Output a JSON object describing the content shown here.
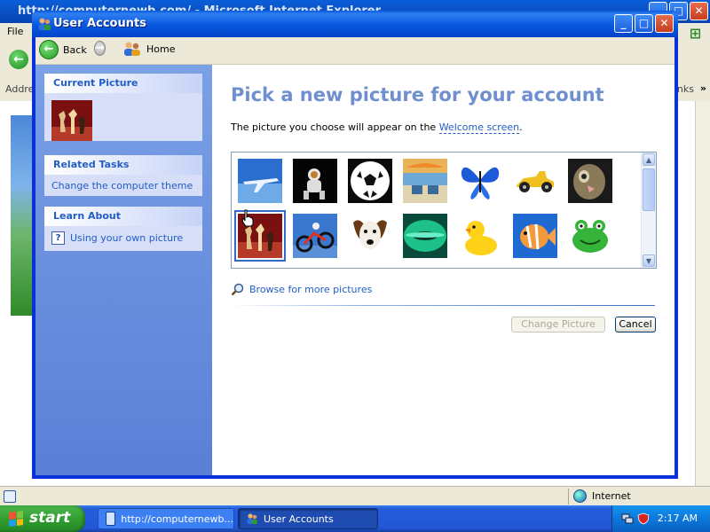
{
  "ie": {
    "title": "http://computernewb.com/ - Microsoft Internet Explorer",
    "menu_file": "File",
    "address_label": "Address",
    "links_label": "Links",
    "status_zone": "Internet"
  },
  "window": {
    "title": "User Accounts",
    "toolbar": {
      "back": "Back",
      "home": "Home"
    }
  },
  "sidebar": {
    "current_picture": {
      "header": "Current Picture"
    },
    "related_tasks": {
      "header": "Related Tasks",
      "items": [
        {
          "label": "Change the computer theme"
        }
      ]
    },
    "learn_about": {
      "header": "Learn About",
      "items": [
        {
          "label": "Using your own picture"
        }
      ]
    }
  },
  "main": {
    "title": "Pick a new picture for your account",
    "description_prefix": "The picture you choose will appear on the ",
    "description_link": "Welcome screen",
    "description_suffix": ".",
    "pictures": [
      {
        "icon": "airplane",
        "selected": false
      },
      {
        "icon": "astronaut",
        "selected": false
      },
      {
        "icon": "soccer-ball",
        "selected": false
      },
      {
        "icon": "beach-chairs",
        "selected": false
      },
      {
        "icon": "butterfly",
        "selected": false
      },
      {
        "icon": "race-car",
        "selected": false
      },
      {
        "icon": "cat",
        "selected": false
      },
      {
        "icon": "chess",
        "selected": true
      },
      {
        "icon": "dirt-bike",
        "selected": false
      },
      {
        "icon": "dog",
        "selected": false
      },
      {
        "icon": "fish-bowl",
        "selected": false
      },
      {
        "icon": "rubber-duck",
        "selected": false
      },
      {
        "icon": "fish",
        "selected": false
      },
      {
        "icon": "frog",
        "selected": false
      }
    ],
    "browse_link": "Browse for more pictures",
    "change_button": "Change Picture",
    "cancel_button": "Cancel"
  },
  "taskbar": {
    "start": "start",
    "tasks": [
      {
        "label": "http://computernewb...",
        "active": false
      },
      {
        "label": "User Accounts",
        "active": true
      }
    ],
    "clock": "2:17 AM"
  },
  "colors": {
    "link": "#215dc6",
    "title_accent": "#6f8fcf",
    "xp_blue": "#0831d9",
    "start_green": "#2e9a2e"
  }
}
